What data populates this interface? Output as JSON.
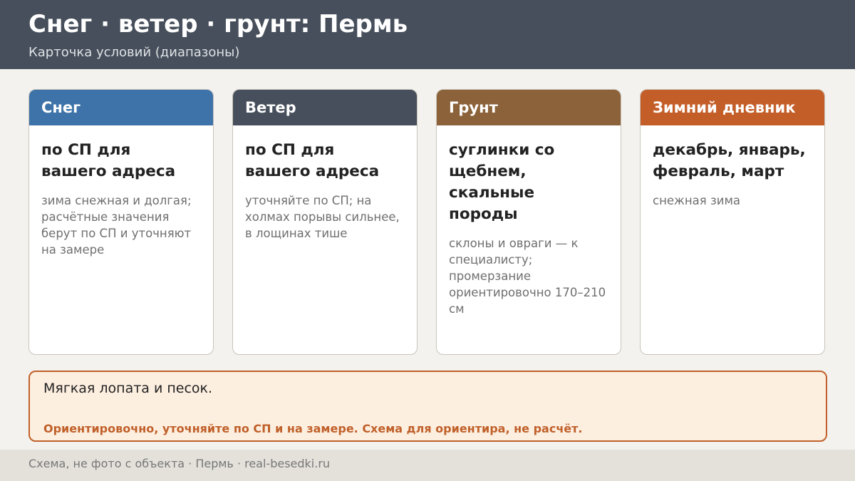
{
  "header": {
    "title": "Снег · ветер · грунт: Пермь",
    "subtitle": "Карточка условий (диапазоны)"
  },
  "cards": [
    {
      "heading": "Снег",
      "color": "#3d73a8",
      "main": "по СП для вашего адреса",
      "note": "зима снежная и долгая; расчётные значения берут по СП и уточняют на замере"
    },
    {
      "heading": "Ветер",
      "color": "#464f5b",
      "main": "по СП для вашего адреса",
      "note": "уточняйте по СП; на холмах порывы сильнее, в лощинах тише"
    },
    {
      "heading": "Грунт",
      "color": "#8b6239",
      "main": "суглинки со щебнем, скальные породы",
      "note": "склоны и овраги — к специалисту; промерзание ориентировочно 170–210 см"
    },
    {
      "heading": "Зимний дневник",
      "color": "#c45e28",
      "main": "декабрь, январь, февраль, март",
      "note": "снежная зима"
    }
  ],
  "note_box": {
    "text": "Мягкая лопата и песок.",
    "warning": "Ориентировочно, уточняйте по СП и на замере. Схема для ориентира, не расчёт."
  },
  "footer": {
    "text": "Схема, не фото с объекта  ·  Пермь  ·  real-besedki.ru"
  }
}
